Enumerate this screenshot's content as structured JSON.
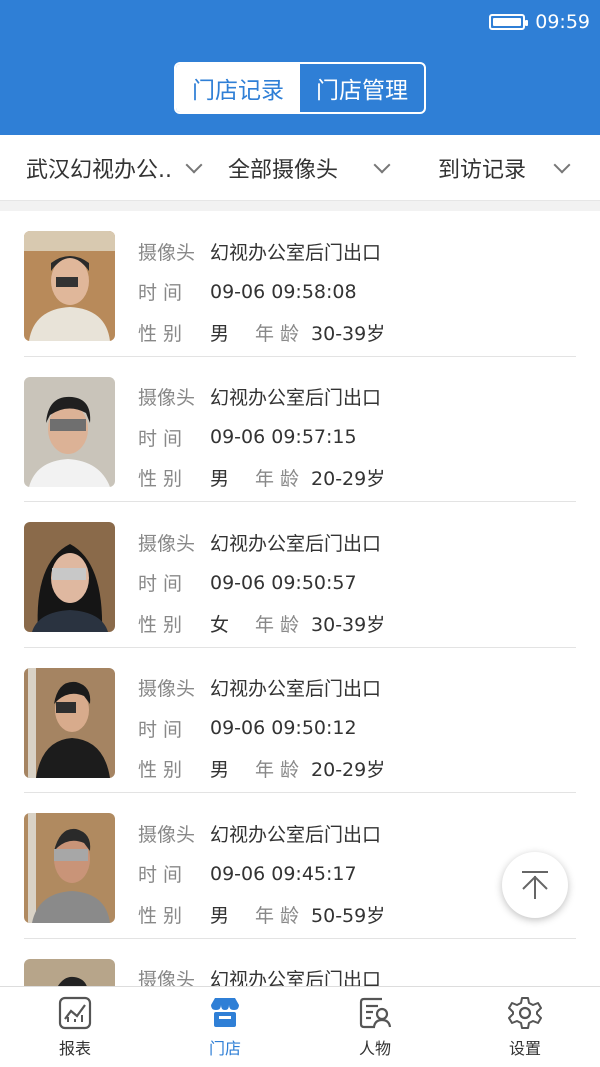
{
  "status": {
    "time": "09:59",
    "battery_icon": "battery-full-icon"
  },
  "header": {
    "tabs": [
      {
        "label": "门店记录",
        "active": true
      },
      {
        "label": "门店管理",
        "active": false
      }
    ]
  },
  "filters": {
    "store": "武汉幻视办公..",
    "camera": "全部摄像头",
    "record_type": "到访记录"
  },
  "labels": {
    "camera": "摄像头",
    "time": "时 间",
    "gender": "性 别",
    "age": "年 龄"
  },
  "records": [
    {
      "camera": "幻视办公室后门出口",
      "time": "09-06 09:58:08",
      "gender": "男",
      "age": "30-39岁"
    },
    {
      "camera": "幻视办公室后门出口",
      "time": "09-06 09:57:15",
      "gender": "男",
      "age": "20-29岁"
    },
    {
      "camera": "幻视办公室后门出口",
      "time": "09-06 09:50:57",
      "gender": "女",
      "age": "30-39岁"
    },
    {
      "camera": "幻视办公室后门出口",
      "time": "09-06 09:50:12",
      "gender": "男",
      "age": "20-29岁"
    },
    {
      "camera": "幻视办公室后门出口",
      "time": "09-06 09:45:17",
      "gender": "男",
      "age": "50-59岁"
    },
    {
      "camera": "幻视办公室后门出口",
      "time": "",
      "gender": "",
      "age": ""
    }
  ],
  "tabbar": [
    {
      "label": "报表",
      "icon": "chart-icon",
      "active": false
    },
    {
      "label": "门店",
      "icon": "store-icon",
      "active": true
    },
    {
      "label": "人物",
      "icon": "person-card-icon",
      "active": false
    },
    {
      "label": "设置",
      "icon": "gear-icon",
      "active": false
    }
  ],
  "colors": {
    "primary": "#2f7fd6"
  }
}
